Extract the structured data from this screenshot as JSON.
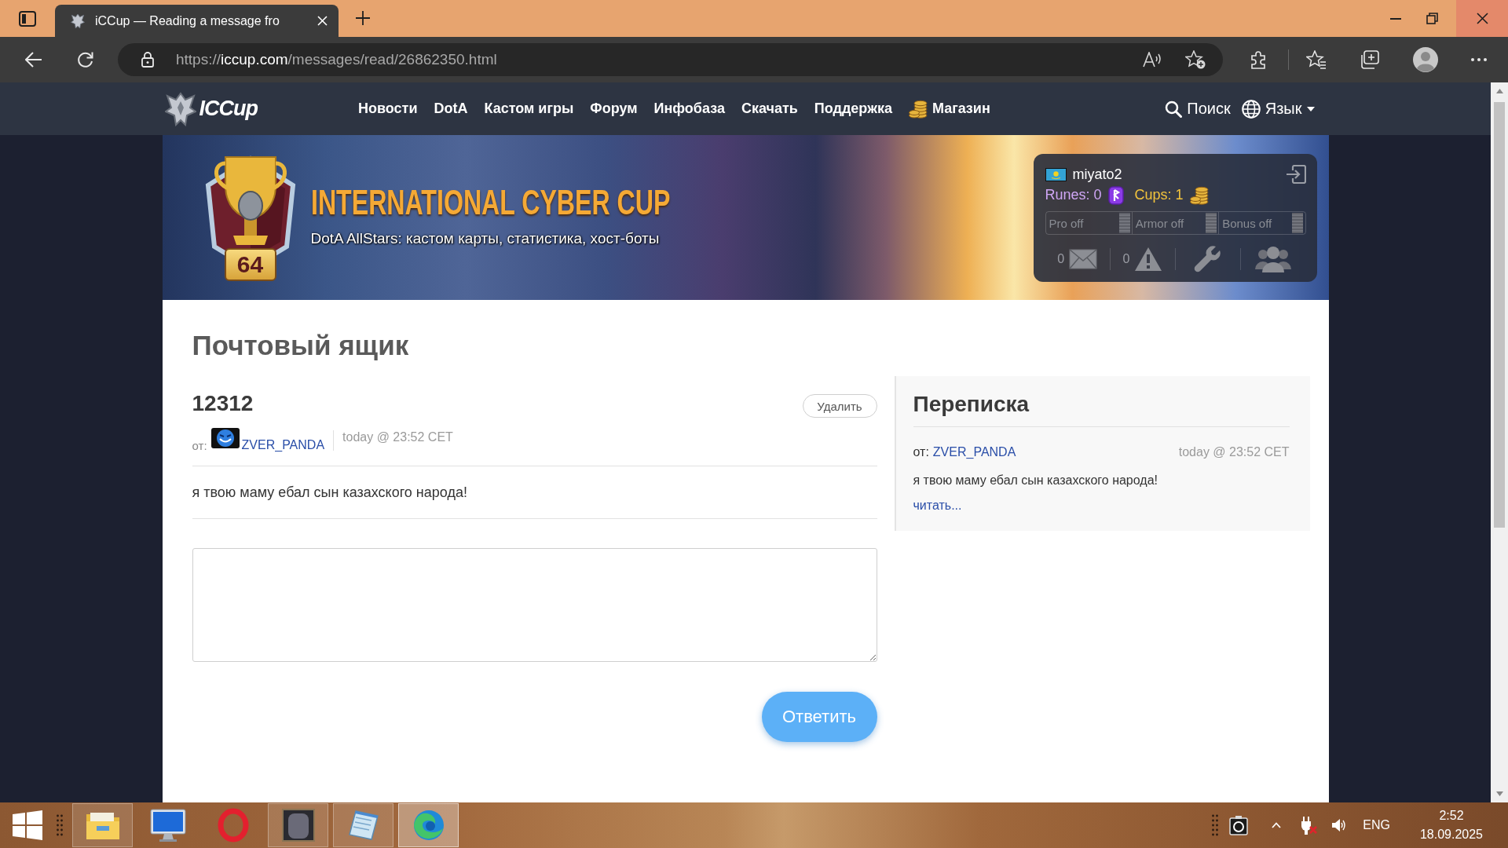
{
  "browser": {
    "tab_title": "iCCup — Reading a message fro",
    "url": {
      "scheme": "https://",
      "domain": "iccup.com",
      "path": "/messages/read/26862350.html"
    }
  },
  "site_nav": {
    "logo": "ICCup",
    "items": [
      {
        "label": "Новости",
        "kind": "link"
      },
      {
        "label": "DotA",
        "kind": "link"
      },
      {
        "label": "Кастом игры",
        "kind": "link"
      },
      {
        "label": "Форум",
        "kind": "link"
      },
      {
        "label": "Инфобаза",
        "kind": "link"
      },
      {
        "label": "Скачать",
        "kind": "link"
      },
      {
        "label": "Поддержка",
        "kind": "link"
      },
      {
        "label": "Магазин",
        "kind": "shop"
      }
    ],
    "search": "Поиск",
    "language": "Язык"
  },
  "banner": {
    "title": "INTERNATIONAL CYBER CUP",
    "subtitle": "DotA AllStars: кастом карты, статистика, хост-боты",
    "rank": "64"
  },
  "user_panel": {
    "username": "miyato2",
    "runes": "Runes: 0",
    "cups": "Cups: 1",
    "toggles": [
      {
        "label": "Pro off",
        "on": false
      },
      {
        "label": "Armor off",
        "on": false
      },
      {
        "label": "Bonus off",
        "on": false
      }
    ],
    "counters": [
      {
        "kind": "mail",
        "count": "0"
      },
      {
        "kind": "warning",
        "count": "0"
      },
      {
        "kind": "tools"
      },
      {
        "kind": "friends"
      }
    ]
  },
  "page_title": "Почтовый ящик",
  "message": {
    "subject": "12312",
    "delete_button": "Удалить",
    "from_label": "от:",
    "sender": "ZVER_PANDA",
    "time": "today @ 23:52 CET",
    "body": "я твою маму ебал сын казахского народа!",
    "reply_button": "Ответить"
  },
  "conversation": {
    "title": "Переписка",
    "items": [
      {
        "from_label": "от:",
        "sender": "ZVER_PANDA",
        "time": "today @ 23:52 CET",
        "excerpt": "я твою маму ебал сын казахского народа!",
        "read_link": "читать..."
      }
    ]
  },
  "taskbar": {
    "apps": [
      {
        "kind": "explorer",
        "running": true,
        "selected": false
      },
      {
        "kind": "monitor",
        "running": false,
        "selected": false
      },
      {
        "kind": "opera",
        "running": false,
        "selected": false
      },
      {
        "kind": "game",
        "running": true,
        "selected": false
      },
      {
        "kind": "notepad",
        "running": true,
        "selected": false
      },
      {
        "kind": "edge",
        "running": true,
        "selected": true
      }
    ],
    "language": "ENG",
    "time": "2:52",
    "date": "18.09.2025"
  }
}
